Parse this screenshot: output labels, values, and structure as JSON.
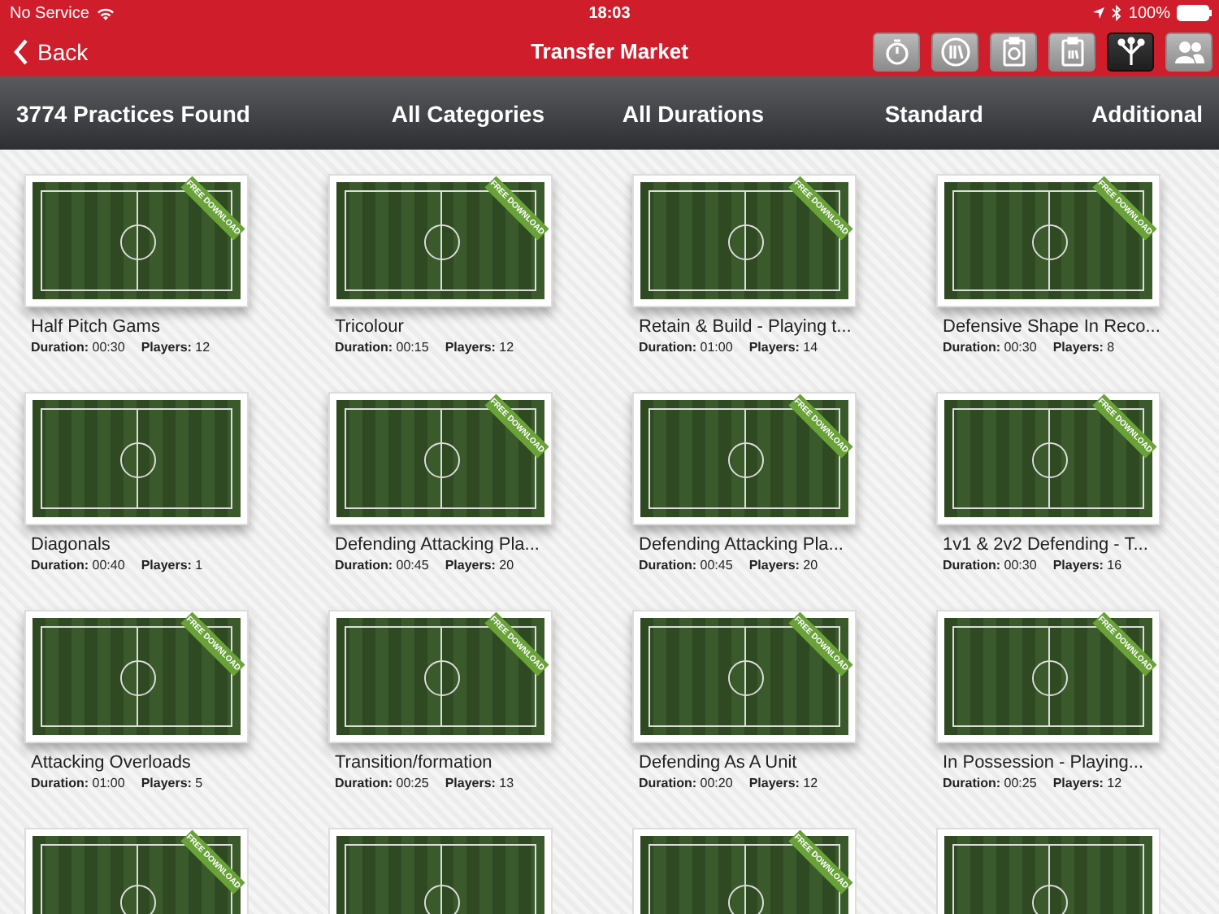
{
  "status_bar": {
    "carrier": "No Service",
    "time": "18:03",
    "battery": "100%"
  },
  "nav": {
    "back": "Back",
    "title": "Transfer Market",
    "tools": [
      {
        "selected": false
      },
      {
        "selected": false
      },
      {
        "selected": false
      },
      {
        "selected": false
      },
      {
        "selected": true
      },
      {
        "selected": false
      }
    ]
  },
  "filter_bar": {
    "count": "3774 Practices Found",
    "filters": [
      "All Categories",
      "All Durations",
      "Standard",
      "Additional"
    ]
  },
  "cards": [
    {
      "title": "Half Pitch Gams",
      "duration_label": "Duration:",
      "duration": "00:30",
      "players_label": "Players:",
      "players": "12",
      "ribbon": "FREE DOWNLOAD"
    },
    {
      "title": "Tricolour",
      "duration_label": "Duration:",
      "duration": "00:15",
      "players_label": "Players:",
      "players": "12",
      "ribbon": "FREE DOWNLOAD"
    },
    {
      "title": "Retain & Build - Playing t...",
      "duration_label": "Duration:",
      "duration": "01:00",
      "players_label": "Players:",
      "players": "14",
      "ribbon": "FREE DOWNLOAD"
    },
    {
      "title": "Defensive Shape In Reco...",
      "duration_label": "Duration:",
      "duration": "00:30",
      "players_label": "Players:",
      "players": "8",
      "ribbon": "FREE DOWNLOAD"
    },
    {
      "title": "Diagonals",
      "duration_label": "Duration:",
      "duration": "00:40",
      "players_label": "Players:",
      "players": "1"
    },
    {
      "title": "Defending Attacking Pla...",
      "duration_label": "Duration:",
      "duration": "00:45",
      "players_label": "Players:",
      "players": "20",
      "ribbon": "FREE DOWNLOAD"
    },
    {
      "title": "Defending Attacking Pla...",
      "duration_label": "Duration:",
      "duration": "00:45",
      "players_label": "Players:",
      "players": "20",
      "ribbon": "FREE DOWNLOAD"
    },
    {
      "title": "1v1 & 2v2 Defending - T...",
      "duration_label": "Duration:",
      "duration": "00:30",
      "players_label": "Players:",
      "players": "16",
      "ribbon": "FREE DOWNLOAD"
    },
    {
      "title": "Attacking Overloads",
      "duration_label": "Duration:",
      "duration": "01:00",
      "players_label": "Players:",
      "players": "5",
      "ribbon": "FREE DOWNLOAD"
    },
    {
      "title": "Transition/formation",
      "duration_label": "Duration:",
      "duration": "00:25",
      "players_label": "Players:",
      "players": "13",
      "ribbon": "FREE DOWNLOAD"
    },
    {
      "title": "Defending As A Unit",
      "duration_label": "Duration:",
      "duration": "00:20",
      "players_label": "Players:",
      "players": "12",
      "ribbon": "FREE DOWNLOAD"
    },
    {
      "title": "In Possession - Playing...",
      "duration_label": "Duration:",
      "duration": "00:25",
      "players_label": "Players:",
      "players": "12",
      "ribbon": "FREE DOWNLOAD"
    },
    {
      "kind": "partial",
      "ribbon": "FREE DOWNLOAD"
    },
    {
      "kind": "partial"
    },
    {
      "kind": "partial",
      "ribbon": "FREE DOWNLOAD"
    },
    {
      "kind": "partial"
    }
  ]
}
